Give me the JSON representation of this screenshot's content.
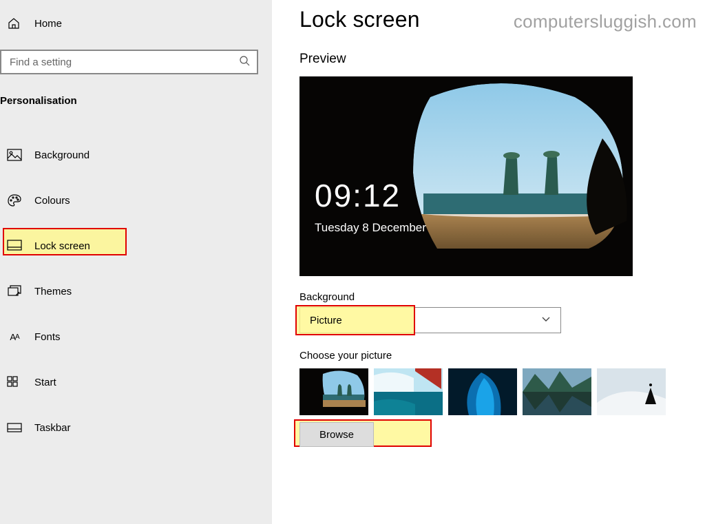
{
  "watermark": "computersluggish.com",
  "sidebar": {
    "home": "Home",
    "search_placeholder": "Find a setting",
    "section": "Personalisation",
    "items": [
      {
        "label": "Background"
      },
      {
        "label": "Colours"
      },
      {
        "label": "Lock screen"
      },
      {
        "label": "Themes"
      },
      {
        "label": "Fonts"
      },
      {
        "label": "Start"
      },
      {
        "label": "Taskbar"
      }
    ]
  },
  "content": {
    "title": "Lock screen",
    "preview_heading": "Preview",
    "preview_time": "09:12",
    "preview_date": "Tuesday 8 December",
    "background_label": "Background",
    "background_select_value": "Picture",
    "choose_label": "Choose your picture",
    "browse_label": "Browse"
  }
}
